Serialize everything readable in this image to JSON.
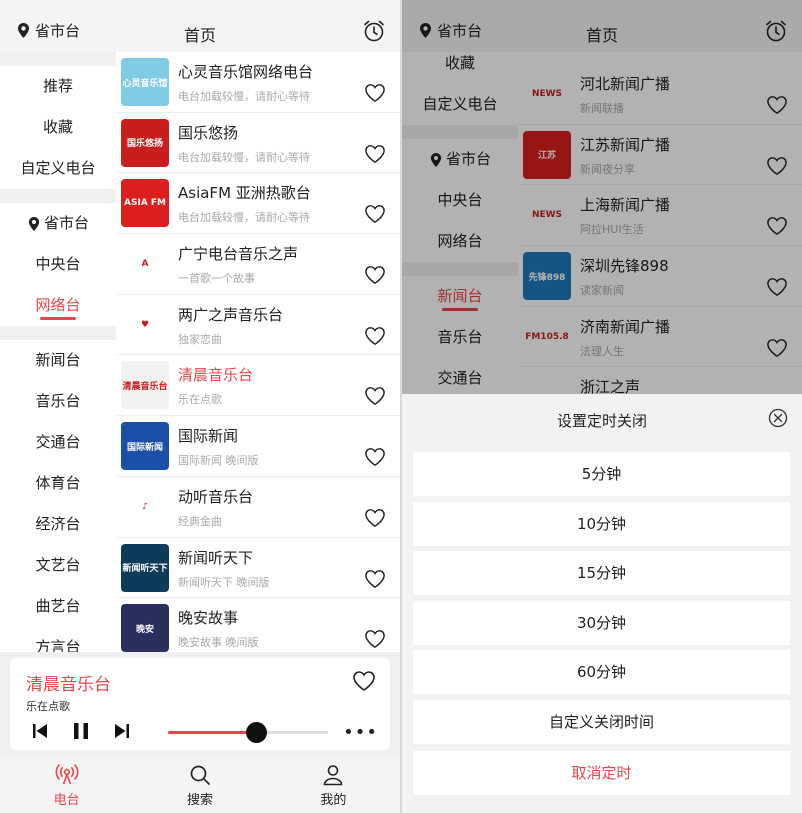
{
  "header": {
    "location_label": "省市台",
    "title": "首页"
  },
  "left": {
    "category_groups": [
      [
        {
          "label": "推荐"
        },
        {
          "label": "收藏"
        },
        {
          "label": "自定义电台"
        }
      ],
      [
        {
          "label": "省市台",
          "icon": "location-icon"
        },
        {
          "label": "中央台"
        },
        {
          "label": "网络台",
          "active": true
        }
      ],
      [
        {
          "label": "新闻台"
        },
        {
          "label": "音乐台"
        },
        {
          "label": "交通台"
        },
        {
          "label": "体育台"
        },
        {
          "label": "经济台"
        },
        {
          "label": "文艺台"
        },
        {
          "label": "曲艺台"
        },
        {
          "label": "方言台"
        }
      ]
    ],
    "stations": [
      {
        "name": "心灵音乐馆网络电台",
        "sub": "电台加载较慢，请耐心等待",
        "logo_text": "心灵音乐馆",
        "logo_bg": "#7fcbe6"
      },
      {
        "name": "国乐悠扬",
        "sub": "电台加载较慢，请耐心等待",
        "logo_text": "国乐悠扬",
        "logo_bg": "#c81e1e"
      },
      {
        "name": "AsiaFM 亚洲热歌台",
        "sub": "电台加载较慢，请耐心等待",
        "logo_text": "ASIA FM",
        "logo_bg": "#d9201f"
      },
      {
        "name": "广宁电台音乐之声",
        "sub": "一首歌一个故事",
        "logo_text": "A",
        "logo_bg": "#ffffff"
      },
      {
        "name": "两广之声音乐台",
        "sub": "独家恋曲",
        "logo_text": "♥",
        "logo_bg": "#ffffff"
      },
      {
        "name": "清晨音乐台",
        "sub": "乐在点歌",
        "logo_text": "清晨音乐台",
        "logo_bg": "#f2f2f2",
        "highlight": true
      },
      {
        "name": "国际新闻",
        "sub": "国际新闻 晚间版",
        "logo_text": "国际新闻",
        "logo_bg": "#1b4fa8"
      },
      {
        "name": "动听音乐台",
        "sub": "经典金曲",
        "logo_text": "♪",
        "logo_bg": "#ffffff"
      },
      {
        "name": "新闻听天下",
        "sub": "新闻听天下 晚间版",
        "logo_text": "新闻听天下",
        "logo_bg": "#0e3b5a"
      },
      {
        "name": "晚安故事",
        "sub": "晚安故事 晚间版",
        "logo_text": "晚安",
        "logo_bg": "#2a2f5e"
      }
    ],
    "player": {
      "name": "清晨音乐台",
      "sub": "乐在点歌",
      "progress": 0.55
    },
    "tabs": [
      {
        "label": "电台",
        "icon": "radio-icon",
        "active": true
      },
      {
        "label": "搜索",
        "icon": "search-icon"
      },
      {
        "label": "我的",
        "icon": "user-icon"
      }
    ]
  },
  "right": {
    "category_groups": [
      [
        {
          "label": "收藏"
        },
        {
          "label": "自定义电台"
        }
      ],
      [
        {
          "label": "省市台",
          "icon": "location-icon"
        },
        {
          "label": "中央台"
        },
        {
          "label": "网络台"
        }
      ],
      [
        {
          "label": "新闻台",
          "active": true
        },
        {
          "label": "音乐台"
        },
        {
          "label": "交通台"
        }
      ]
    ],
    "stations": [
      {
        "name": "河北新闻广播",
        "sub": "新闻联播",
        "logo_text": "NEWS",
        "logo_bg": "#ffffff"
      },
      {
        "name": "江苏新闻广播",
        "sub": "新闻夜分享",
        "logo_text": "江苏",
        "logo_bg": "#d9201f"
      },
      {
        "name": "上海新闻广播",
        "sub": "阿拉HUI生活",
        "logo_text": "NEWS",
        "logo_bg": "#ffffff"
      },
      {
        "name": "深圳先锋898",
        "sub": "读家新闻",
        "logo_text": "先锋898",
        "logo_bg": "#1f7ac1"
      },
      {
        "name": "济南新闻广播",
        "sub": "法理人生",
        "logo_text": "FM105.8",
        "logo_bg": "#ffffff"
      },
      {
        "name": "浙江之声",
        "sub": "",
        "logo_text": "",
        "logo_bg": "#ffffff"
      }
    ],
    "timer_sheet": {
      "title": "设置定时关闭",
      "options": [
        {
          "label": "5分钟"
        },
        {
          "label": "10分钟"
        },
        {
          "label": "15分钟"
        },
        {
          "label": "30分钟"
        },
        {
          "label": "60分钟"
        },
        {
          "label": "自定义关闭时间"
        }
      ],
      "cancel_label": "取消定时"
    }
  },
  "colors": {
    "accent": "#e8474b",
    "text": "#222222",
    "subtext": "#aaaaaa",
    "bg": "#f2f2f2"
  }
}
